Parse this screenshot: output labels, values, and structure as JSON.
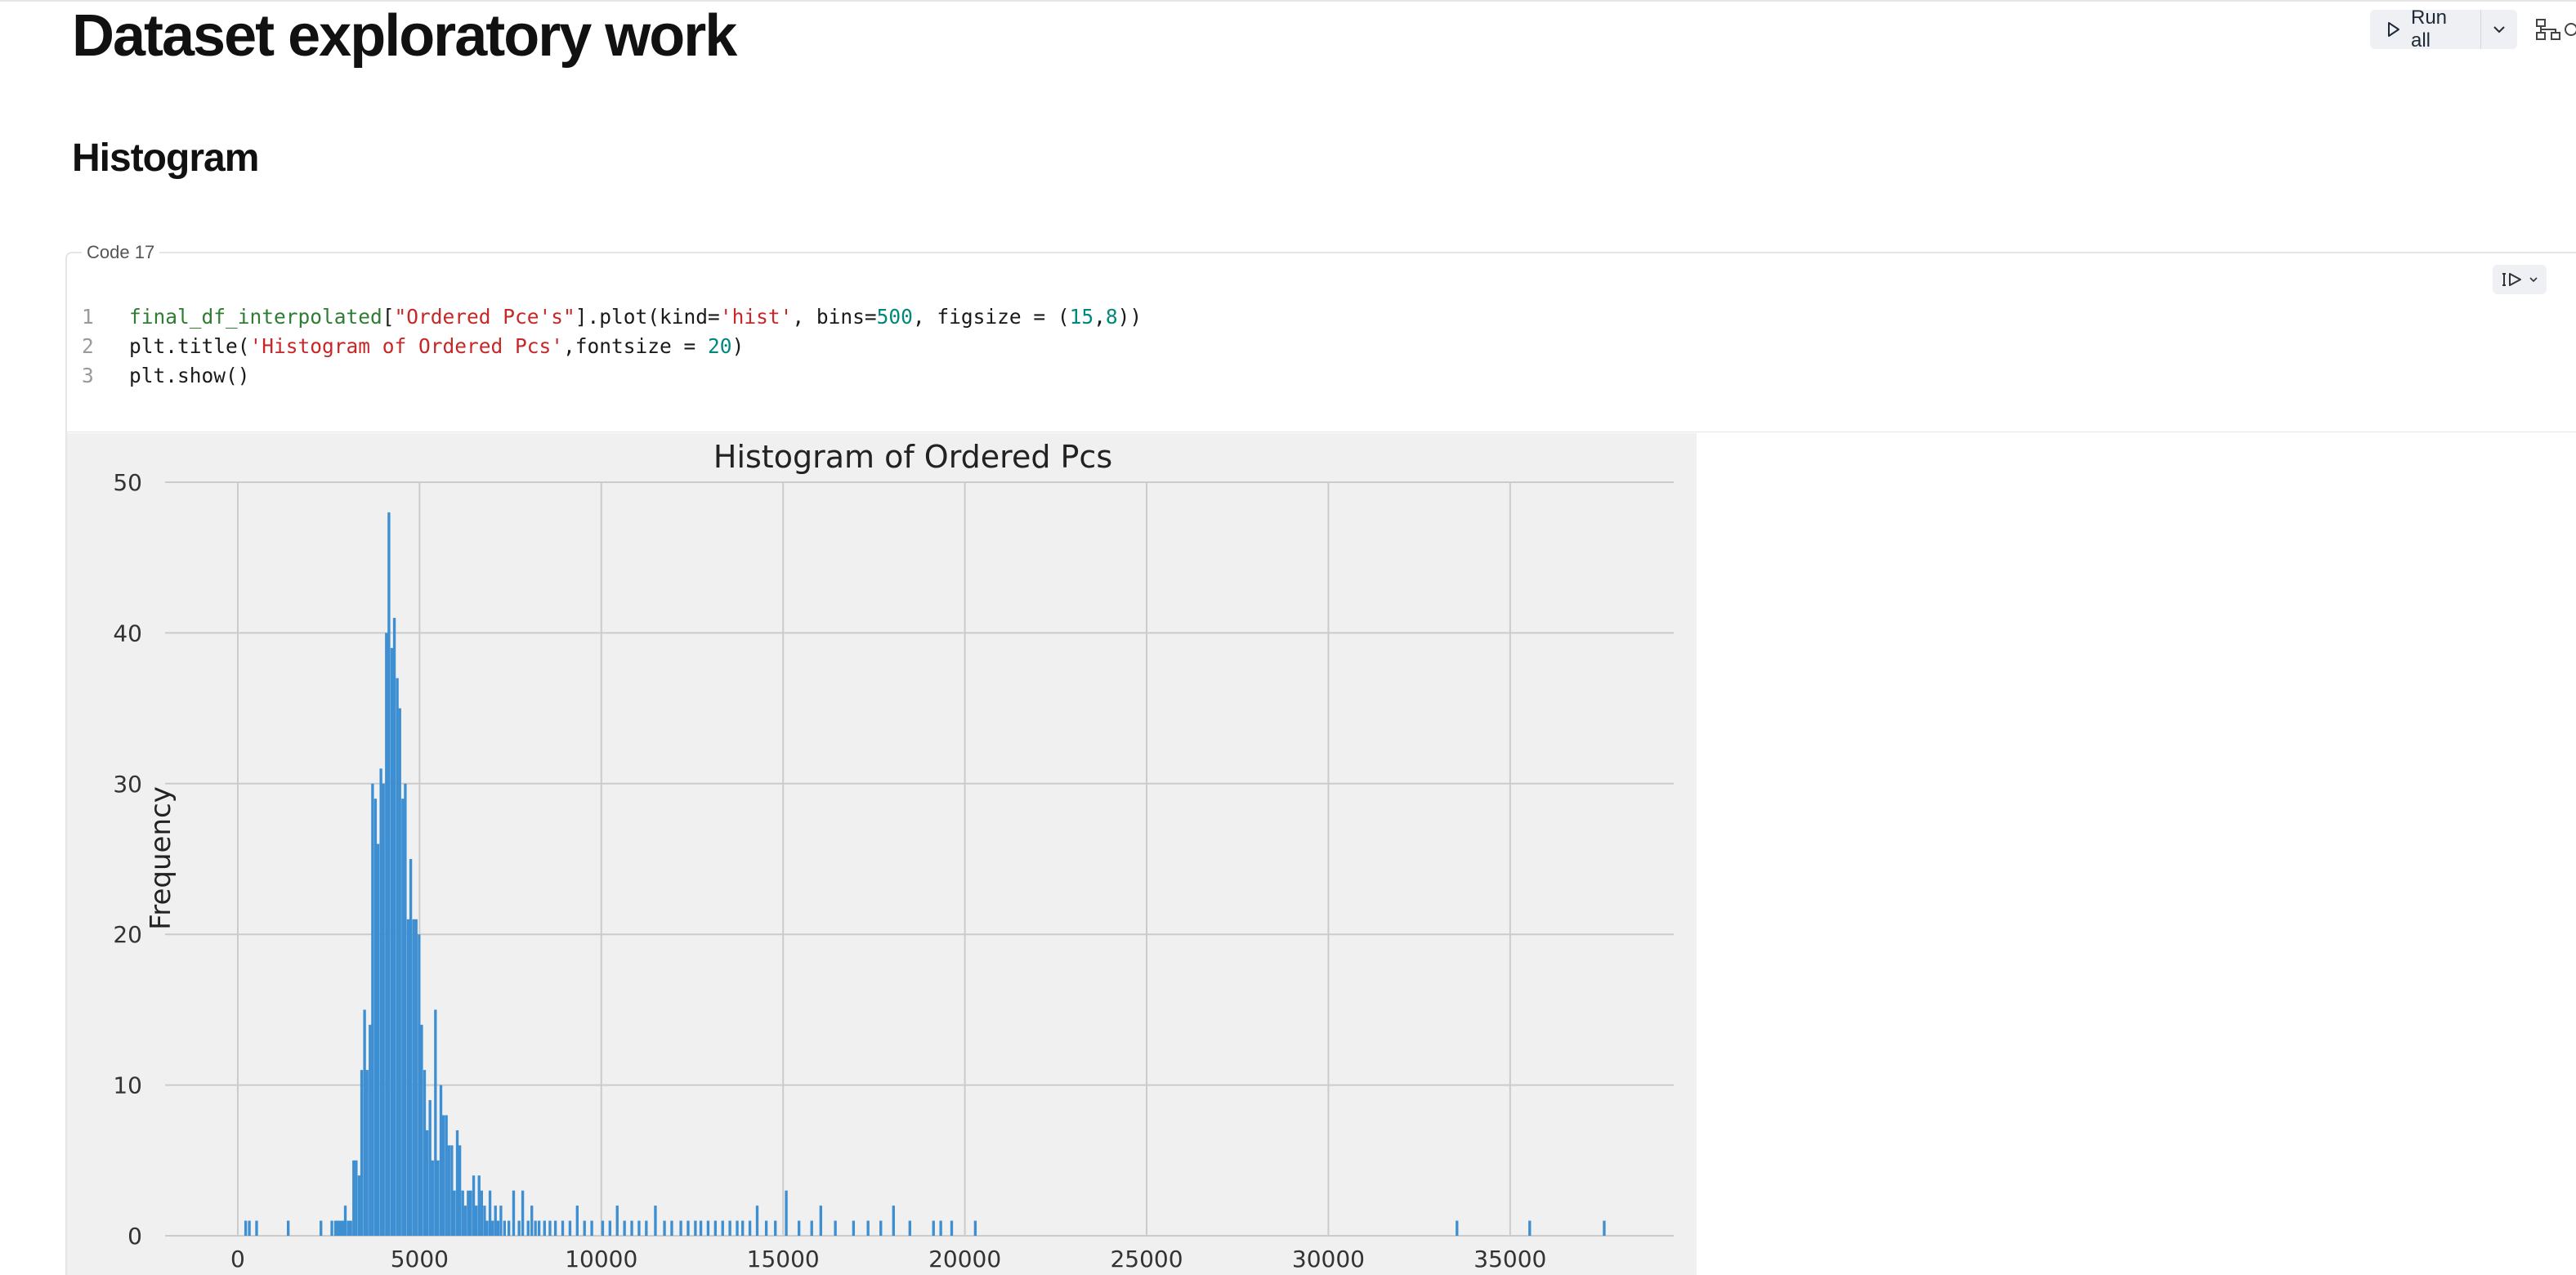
{
  "page": {
    "title": "Dataset exploratory work",
    "section_heading": "Histogram"
  },
  "toolbar": {
    "run_all_label": "Run all",
    "run_all_icon": "play-icon",
    "dropdown_icon": "chevron-down-icon",
    "extra_icon": "dependency-graph-icon"
  },
  "cell": {
    "label": "Code 17",
    "run_icon": "run-cell-icon",
    "code_lines": [
      {
        "number": "1",
        "tokens": [
          {
            "text": "final_df_interpolated",
            "kind": "fn"
          },
          {
            "text": "[",
            "kind": "plain"
          },
          {
            "text": "\"Ordered Pce's\"",
            "kind": "str"
          },
          {
            "text": "].plot(kind=",
            "kind": "plain"
          },
          {
            "text": "'hist'",
            "kind": "str"
          },
          {
            "text": ", bins=",
            "kind": "plain"
          },
          {
            "text": "500",
            "kind": "num"
          },
          {
            "text": ", figsize = (",
            "kind": "plain"
          },
          {
            "text": "15",
            "kind": "num"
          },
          {
            "text": ",",
            "kind": "plain"
          },
          {
            "text": "8",
            "kind": "num"
          },
          {
            "text": "))",
            "kind": "plain"
          }
        ]
      },
      {
        "number": "2",
        "tokens": [
          {
            "text": "plt.title(",
            "kind": "plain"
          },
          {
            "text": "'Histogram of Ordered Pcs'",
            "kind": "str"
          },
          {
            "text": ",fontsize = ",
            "kind": "plain"
          },
          {
            "text": "20",
            "kind": "num"
          },
          {
            "text": ")",
            "kind": "plain"
          }
        ]
      },
      {
        "number": "3",
        "tokens": [
          {
            "text": "plt.show()",
            "kind": "plain"
          }
        ]
      }
    ]
  },
  "chart_data": {
    "type": "bar",
    "title": "Histogram of Ordered Pcs",
    "xlabel": "",
    "ylabel": "Frequency",
    "xlim": [
      -2000,
      39500
    ],
    "ylim": [
      0,
      50
    ],
    "xticks": [
      0,
      5000,
      10000,
      15000,
      20000,
      25000,
      30000,
      35000
    ],
    "yticks": [
      0,
      10,
      20,
      30,
      40,
      50
    ],
    "grid": true,
    "bar_color": "#3d8fd1",
    "background_color": "#f0f0f0",
    "grid_color": "#cbcbcb",
    "bin_width": 75,
    "values_note_bins": [
      [
        180,
        1
      ],
      [
        280,
        1
      ],
      [
        480,
        1
      ],
      [
        1350,
        1
      ],
      [
        2250,
        1
      ],
      [
        2550,
        1
      ],
      [
        2650,
        1
      ],
      [
        2720,
        1
      ],
      [
        2780,
        1
      ],
      [
        2850,
        1
      ],
      [
        2920,
        2
      ],
      [
        3000,
        1
      ],
      [
        3070,
        1
      ],
      [
        3150,
        5
      ],
      [
        3220,
        5
      ],
      [
        3300,
        4
      ],
      [
        3370,
        11
      ],
      [
        3450,
        15
      ],
      [
        3520,
        11
      ],
      [
        3600,
        14
      ],
      [
        3670,
        30
      ],
      [
        3750,
        29
      ],
      [
        3820,
        26
      ],
      [
        3900,
        31
      ],
      [
        3970,
        30
      ],
      [
        4050,
        40
      ],
      [
        4120,
        48
      ],
      [
        4200,
        39
      ],
      [
        4270,
        41
      ],
      [
        4350,
        37
      ],
      [
        4420,
        35
      ],
      [
        4500,
        29
      ],
      [
        4570,
        30
      ],
      [
        4650,
        21
      ],
      [
        4720,
        25
      ],
      [
        4800,
        21
      ],
      [
        4870,
        21
      ],
      [
        4950,
        20
      ],
      [
        5020,
        14
      ],
      [
        5100,
        11
      ],
      [
        5170,
        7
      ],
      [
        5250,
        9
      ],
      [
        5320,
        5
      ],
      [
        5400,
        15
      ],
      [
        5470,
        5
      ],
      [
        5550,
        10
      ],
      [
        5620,
        8
      ],
      [
        5700,
        8
      ],
      [
        5770,
        6
      ],
      [
        5850,
        6
      ],
      [
        5920,
        3
      ],
      [
        6000,
        7
      ],
      [
        6070,
        6
      ],
      [
        6150,
        3
      ],
      [
        6220,
        2
      ],
      [
        6300,
        3
      ],
      [
        6370,
        3
      ],
      [
        6450,
        4
      ],
      [
        6520,
        2
      ],
      [
        6600,
        4
      ],
      [
        6670,
        3
      ],
      [
        6750,
        2
      ],
      [
        6820,
        1
      ],
      [
        6900,
        3
      ],
      [
        6970,
        1
      ],
      [
        7050,
        2
      ],
      [
        7120,
        1
      ],
      [
        7200,
        2
      ],
      [
        7300,
        1
      ],
      [
        7420,
        1
      ],
      [
        7550,
        3
      ],
      [
        7700,
        1
      ],
      [
        7800,
        3
      ],
      [
        7950,
        1
      ],
      [
        8050,
        2
      ],
      [
        8150,
        1
      ],
      [
        8250,
        1
      ],
      [
        8400,
        1
      ],
      [
        8550,
        1
      ],
      [
        8700,
        1
      ],
      [
        8900,
        1
      ],
      [
        9100,
        1
      ],
      [
        9300,
        2
      ],
      [
        9500,
        1
      ],
      [
        9700,
        1
      ],
      [
        10000,
        1
      ],
      [
        10200,
        1
      ],
      [
        10400,
        2
      ],
      [
        10600,
        1
      ],
      [
        10800,
        1
      ],
      [
        11000,
        1
      ],
      [
        11200,
        1
      ],
      [
        11450,
        2
      ],
      [
        11700,
        1
      ],
      [
        11900,
        1
      ],
      [
        12150,
        1
      ],
      [
        12350,
        1
      ],
      [
        12550,
        1
      ],
      [
        12700,
        1
      ],
      [
        12900,
        1
      ],
      [
        13100,
        1
      ],
      [
        13300,
        1
      ],
      [
        13500,
        1
      ],
      [
        13700,
        1
      ],
      [
        13850,
        1
      ],
      [
        14050,
        1
      ],
      [
        14250,
        2
      ],
      [
        14500,
        1
      ],
      [
        14750,
        1
      ],
      [
        15050,
        3
      ],
      [
        15400,
        1
      ],
      [
        15750,
        1
      ],
      [
        16000,
        2
      ],
      [
        16400,
        1
      ],
      [
        16900,
        1
      ],
      [
        17300,
        1
      ],
      [
        17650,
        1
      ],
      [
        18000,
        2
      ],
      [
        18450,
        1
      ],
      [
        19100,
        1
      ],
      [
        19300,
        1
      ],
      [
        19600,
        1
      ],
      [
        20250,
        1
      ],
      [
        33500,
        1
      ],
      [
        35500,
        1
      ],
      [
        37550,
        1
      ]
    ]
  }
}
